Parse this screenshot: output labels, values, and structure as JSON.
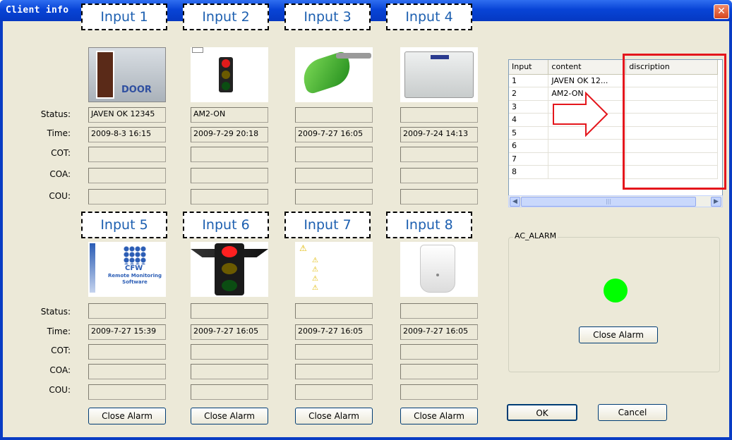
{
  "window": {
    "title": "Client info"
  },
  "labels": {
    "status": "Status:",
    "time": "Time:",
    "cot": "COT:",
    "coa": "COA:",
    "cou": "COU:"
  },
  "inputs_top": [
    {
      "tag": "Input 1",
      "status": "JAVEN OK 12345",
      "time": "2009-8-3  16:15",
      "image": "door-image"
    },
    {
      "tag": "Input 2",
      "status": "AM2-ON",
      "time": "2009-7-29  20:18",
      "image": "traffic-light-image"
    },
    {
      "tag": "Input 3",
      "status": "",
      "time": "2009-7-27  16:05",
      "image": "fuel-nozzle-image"
    },
    {
      "tag": "Input 4",
      "status": "",
      "time": "2009-7-24  14:13",
      "image": "control-box-image"
    }
  ],
  "inputs_bottom": [
    {
      "tag": "Input 5",
      "status": "",
      "time": "2009-7-27  15:39",
      "image": "cfw-logo-image"
    },
    {
      "tag": "Input 6",
      "status": "",
      "time": "2009-7-27  16:05",
      "image": "traffic-light-image"
    },
    {
      "tag": "Input 7",
      "status": "",
      "time": "2009-7-27  16:05",
      "image": "warning-list-image"
    },
    {
      "tag": "Input 8",
      "status": "",
      "time": "2009-7-27  16:05",
      "image": "pir-sensor-image"
    }
  ],
  "image_texts": {
    "door": "DOOR",
    "cfw_big": "CFW",
    "cfw_small": "Remote Monitoring Software"
  },
  "close_alarm_label": "Close Alarm",
  "table": {
    "headers": [
      "Input",
      "content",
      "discription"
    ],
    "rows": [
      [
        "1",
        "JAVEN OK 12...",
        ""
      ],
      [
        "2",
        "AM2-ON",
        ""
      ],
      [
        "3",
        "",
        ""
      ],
      [
        "4",
        "",
        ""
      ],
      [
        "5",
        "",
        ""
      ],
      [
        "6",
        "",
        ""
      ],
      [
        "7",
        "",
        ""
      ],
      [
        "8",
        "",
        ""
      ]
    ]
  },
  "alarm_group": {
    "title": "AC_ALARM",
    "close_label": "Close Alarm",
    "led_color": "#00ff00"
  },
  "dialog": {
    "ok": "OK",
    "cancel": "Cancel"
  },
  "colors": {
    "annotation_red": "#e4161c",
    "tag_blue": "#1c5fb0",
    "title_bar": "#0a3cc4"
  }
}
